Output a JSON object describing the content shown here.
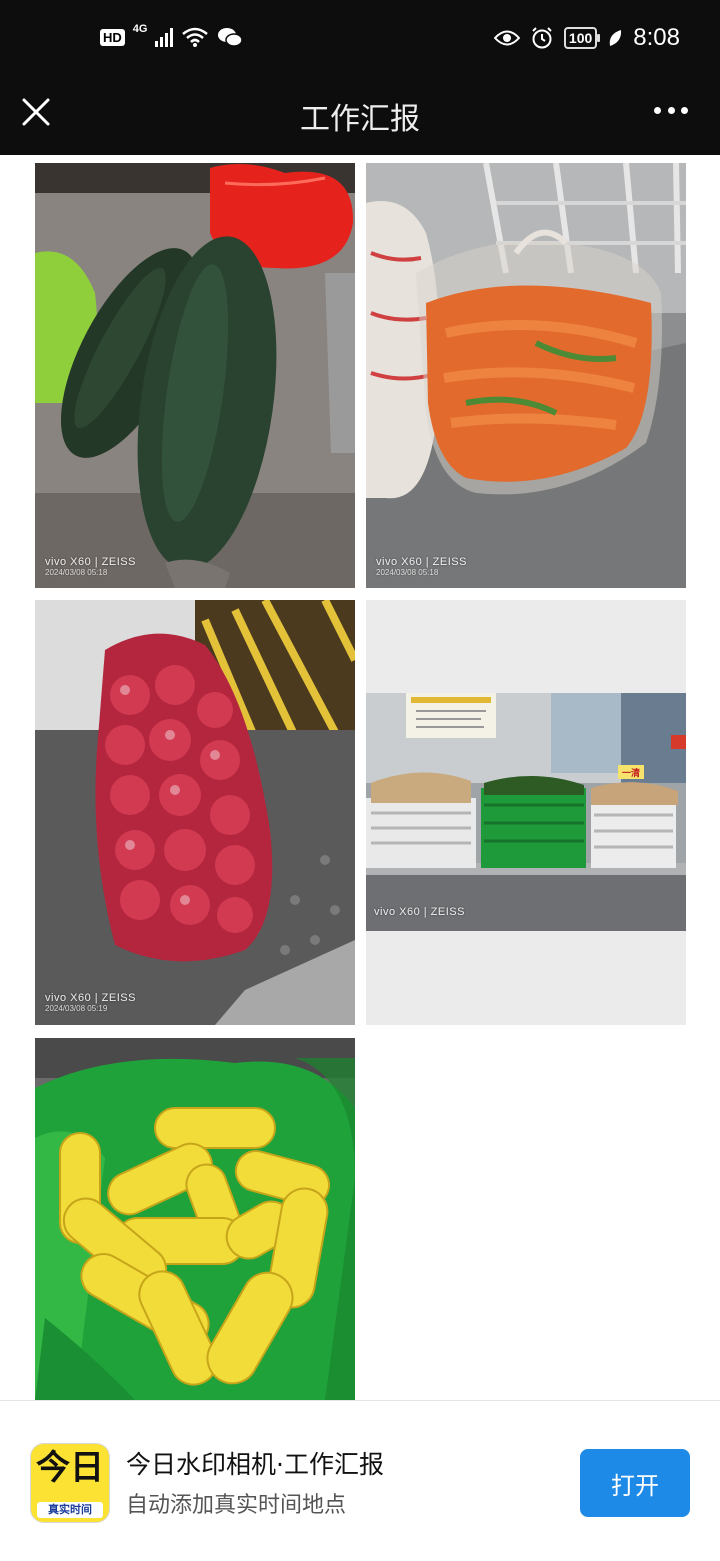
{
  "status_bar": {
    "hd_badge": "HD",
    "network": "4G",
    "battery": "100",
    "time": "8:08"
  },
  "nav": {
    "title": "工作汇报",
    "close_icon": "close-icon",
    "more_icon": "more-icon"
  },
  "photos": [
    {
      "subject": "winter melons",
      "watermark_camera": "vivo X60 | ZEISS",
      "watermark_datetime": "2024/03/08 05:18"
    },
    {
      "subject": "carrots in plastic bag",
      "watermark_camera": "vivo X60 | ZEISS",
      "watermark_datetime": "2024/03/08 05:18"
    },
    {
      "subject": "red onions in net bag",
      "watermark_camera": "vivo X60 | ZEISS",
      "watermark_datetime": "2024/03/08 05:19"
    },
    {
      "subject": "leafy greens in baskets",
      "watermark_camera": "vivo X60 | ZEISS",
      "sign_text": "一清"
    },
    {
      "subject": "corn cobs in green bag"
    }
  ],
  "promo": {
    "icon_main": "今日",
    "icon_sub": "真实时间",
    "title": "今日水印相机·工作汇报",
    "subtitle": "自动添加真实时间地点",
    "open_label": "打开"
  },
  "colors": {
    "accent": "#1e8ae8",
    "bar_bg": "#0d0d0d",
    "icon_yellow": "#fbe233"
  }
}
